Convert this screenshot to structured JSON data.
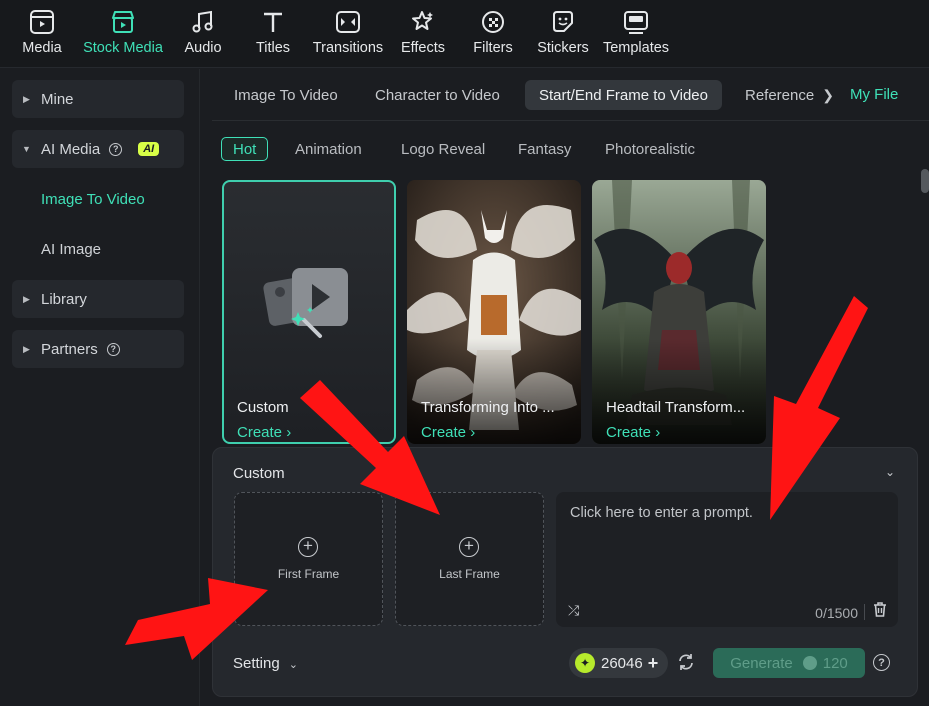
{
  "toolbar": {
    "items": [
      {
        "label": "Media",
        "icon": "media-icon"
      },
      {
        "label": "Stock Media",
        "icon": "stock-media-icon",
        "active": true
      },
      {
        "label": "Audio",
        "icon": "music-note-icon"
      },
      {
        "label": "Titles",
        "icon": "text-t-icon"
      },
      {
        "label": "Transitions",
        "icon": "transitions-icon"
      },
      {
        "label": "Effects",
        "icon": "effects-icon"
      },
      {
        "label": "Filters",
        "icon": "filters-icon"
      },
      {
        "label": "Stickers",
        "icon": "stickers-icon"
      },
      {
        "label": "Templates",
        "icon": "templates-icon"
      }
    ]
  },
  "sidebar": {
    "mine": "Mine",
    "ai_media": "AI Media",
    "ai_badge": "AI",
    "sub_items": [
      "Image To Video",
      "AI Image"
    ],
    "library": "Library",
    "partners": "Partners"
  },
  "tabs": {
    "items": [
      "Image To Video",
      "Character to Video",
      "Start/End Frame to Video",
      "Reference"
    ],
    "active": "Start/End Frame to Video",
    "my_file": "My File"
  },
  "chips": {
    "items": [
      "Hot",
      "Animation",
      "Logo Reveal",
      "Fantasy",
      "Photorealistic"
    ],
    "active": "Hot"
  },
  "cards": [
    {
      "title": "Custom",
      "action": "Create"
    },
    {
      "title": "Transforming Into ...",
      "action": "Create"
    },
    {
      "title": "Headtail Transform...",
      "action": "Create"
    }
  ],
  "panel": {
    "title": "Custom",
    "first_frame": "First Frame",
    "last_frame": "Last Frame",
    "prompt_placeholder": "Click here to enter a prompt.",
    "char_count": "0/1500",
    "setting": "Setting",
    "credits": "26046",
    "generate": "Generate",
    "generate_cost": "120"
  },
  "colors": {
    "accent": "#3fe0b7",
    "annotation_arrow": "#ff1414",
    "ai_badge": "#d8ff47"
  }
}
